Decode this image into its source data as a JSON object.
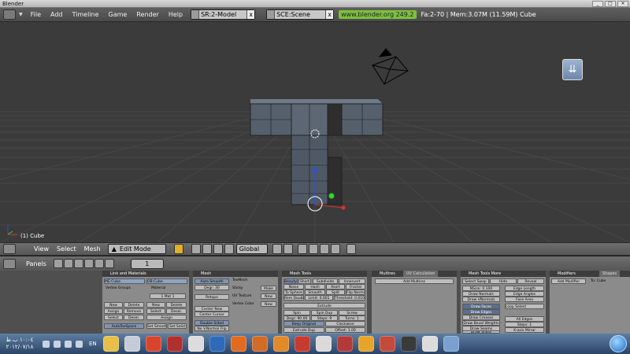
{
  "window": {
    "title": "Blender",
    "min": "_",
    "max": "□",
    "close": "×"
  },
  "info_header": {
    "menus": [
      "File",
      "Add",
      "Timeline",
      "Game",
      "Render",
      "Help"
    ],
    "screen_field": "SR:2-Model",
    "scene_field": "SCE:Scene",
    "url": "www.blender.org 249.2",
    "stats": "Fa:2-70 | Mem:3.07M (11.59M) Cube",
    "close_x": "x"
  },
  "viewport": {
    "object_label": "(1) Cube",
    "nav_glyph": "⇊"
  },
  "view_header": {
    "menus": [
      "View",
      "Select",
      "Mesh"
    ],
    "mode": "Edit Mode",
    "orientation": "Global"
  },
  "buttons_header": {
    "menu": "Panels",
    "frame": "1"
  },
  "panels": {
    "link": {
      "title": "Link and Materials",
      "me_field": "ME:Cube",
      "ob_field": "OB:Cube",
      "vertex_groups": "Vertex Groups",
      "material": "Material",
      "mat_slot": "1 Mat 1",
      "new": "New",
      "delete": "Delete",
      "assign": "Assign",
      "remove": "Remove",
      "select": "Select",
      "deselect": "Desel.",
      "assign2": "Assign",
      "autotexspace": "AutoTexSpace",
      "set_smooth": "Set Smooth",
      "set_solid": "Set Solid"
    },
    "mesh": {
      "title": "Mesh",
      "auto_smooth": "Auto Smooth",
      "degr": "Degr: 30",
      "retopo": "Retopo",
      "center_new": "Center New",
      "center_cursor": "Center Cursor",
      "double_sided": "Double Sided",
      "no_vnormal_flip": "No V.Normal Flip",
      "texmesh": "TexMesh:",
      "sticky": "Sticky",
      "uv_texture": "UV Texture",
      "vertex_color": "Vertex Color",
      "make": "Make",
      "new": "New",
      "new2": "New"
    },
    "mesh_tools": {
      "title": "Mesh Tools",
      "beauty": "Beauty",
      "short": "Short",
      "subdivide": "Subdivide",
      "innervert": "Innervert",
      "noise": "Noise",
      "hash": "Hash",
      "xsort": "Xsort",
      "fractal": "Fractal",
      "to_sphere": "To Sphere",
      "smooth": "Smooth",
      "split": "Split",
      "flip_normal": "Flip Normal",
      "rem_doubles": "Rem Doubles",
      "limit": "Limit: 0.001",
      "threshold": "Threshold: 0.010",
      "extrude": "Extrude",
      "spin": "Spin",
      "spin_dup": "Spin Dup",
      "screw": "Screw",
      "degr": "Degr: 90.00",
      "steps": "Steps: 9",
      "turns": "Turns: 1",
      "keep_original": "Keep Original",
      "clockwise": "Clockwise",
      "extrude_dup": "Extrude Dup",
      "offset": "Offset: 1.00"
    },
    "multires": {
      "title": "Multires",
      "tab2": "UV Calculation",
      "add_multires": "Add Multires"
    },
    "mesh_tools_more": {
      "title": "Mesh Tools More",
      "select_swap": "Select Swap",
      "hide": "Hide",
      "reveal": "Reveal",
      "nsize": "NSize: 0.100",
      "draw_normals": "Draw Normals",
      "draw_vnormals": "Draw VNormals",
      "edge_length": "Edge Length",
      "edge_angles": "Edge Angles",
      "face_area": "Face Area",
      "loop_select": "Loop Select",
      "draw_faces": "Draw Faces",
      "draw_edges": "Draw Edges",
      "draw_creases": "Draw Creases",
      "draw_bevel_weights": "Draw Bevel Weights",
      "draw_seams": "Draw Seams",
      "draw_sharp": "Draw Sharp",
      "all_edges": "All Edges",
      "steps": "Steps: 1",
      "x_axis_mirror": "X-axis Mirror"
    },
    "modifiers": {
      "title": "Modifiers",
      "tab2": "Shapes",
      "add_modifier": "Add Modifier",
      "to": "To: Cube"
    }
  },
  "taskbar": {
    "time": "١٠:٠٤ ب.ظ",
    "date": "٢٠١٢/٠٧/١٨",
    "lang": "EN",
    "app_colors": [
      "#e6c04a",
      "#c7cbd6",
      "#d8452e",
      "#b0302c",
      "#dcdcdc",
      "#2e6ab7",
      "#e36a1f",
      "#d06b28",
      "#e08a2a",
      "#c73a2e",
      "#dadada",
      "#b23a3a",
      "#e6a52a",
      "#c34b3b",
      "#3a3a3a",
      "#dcdcdc",
      "#7aa0d0"
    ]
  }
}
